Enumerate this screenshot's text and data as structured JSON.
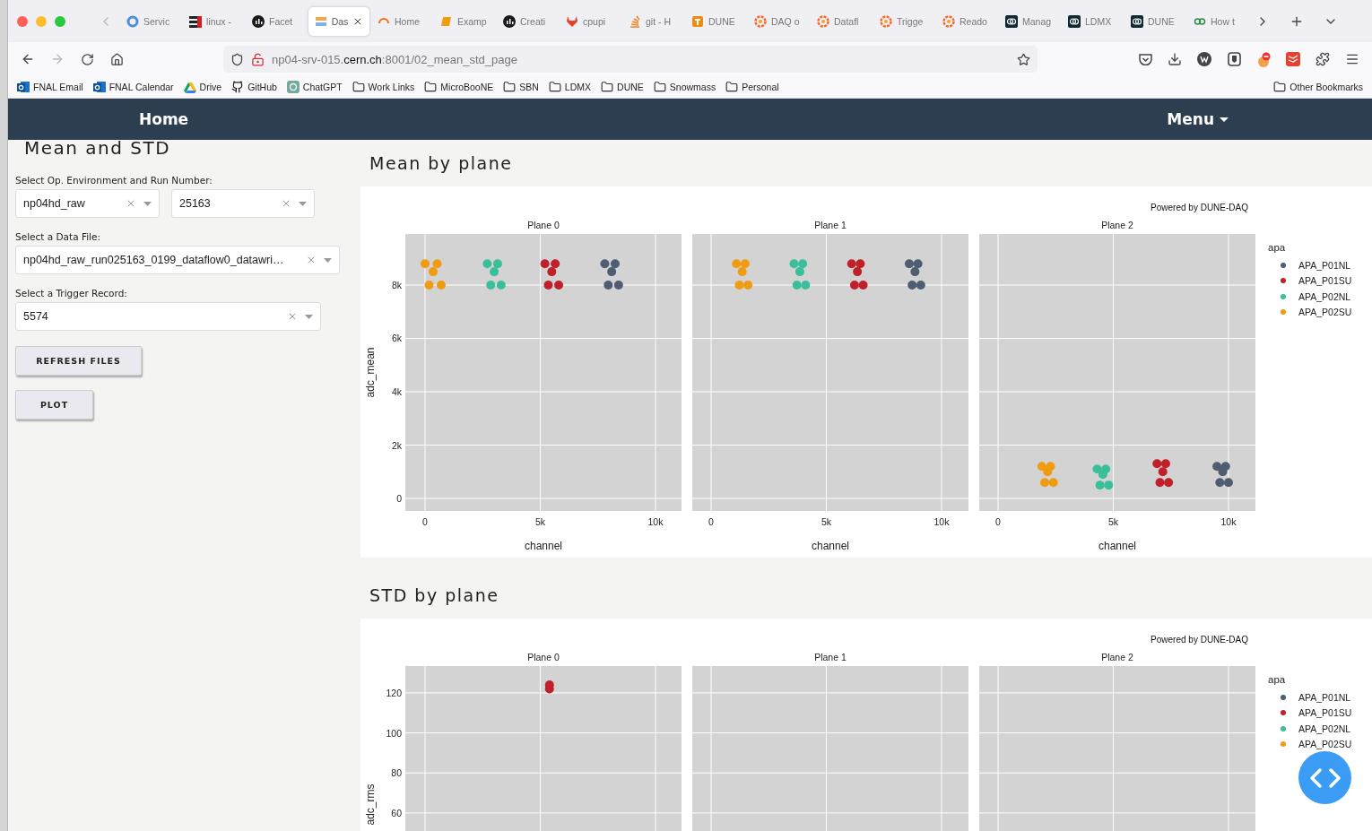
{
  "browser": {
    "tabs": [
      {
        "title": "Servic",
        "kind": "ring",
        "selected": false
      },
      {
        "title": "linux -",
        "kind": "bars",
        "selected": false
      },
      {
        "title": "Facet",
        "kind": "dark",
        "selected": false
      },
      {
        "title": "Das",
        "kind": "dune",
        "selected": true
      },
      {
        "title": "Home",
        "kind": "arc",
        "selected": false
      },
      {
        "title": "Examp",
        "kind": "book",
        "selected": false
      },
      {
        "title": "Creati",
        "kind": "dark",
        "selected": false
      },
      {
        "title": "cpupi",
        "kind": "fox",
        "selected": false
      },
      {
        "title": "git - H",
        "kind": "stack",
        "selected": false
      },
      {
        "title": "DUNE",
        "kind": "tile",
        "selected": false
      },
      {
        "title": "DAQ o",
        "kind": "grafana",
        "selected": false
      },
      {
        "title": "Datafl",
        "kind": "grafana",
        "selected": false
      },
      {
        "title": "Trigge",
        "kind": "grafana",
        "selected": false
      },
      {
        "title": "Reado",
        "kind": "grafana",
        "selected": false
      },
      {
        "title": "Manag",
        "kind": "swirl",
        "selected": false
      },
      {
        "title": "LDMX",
        "kind": "swirl",
        "selected": false
      },
      {
        "title": "DUNE",
        "kind": "swirl",
        "selected": false
      },
      {
        "title": "How t",
        "kind": "gg",
        "selected": false
      }
    ],
    "forward_disabled": true,
    "url": {
      "host": "np04-srv-015.",
      "domain": "cern.ch",
      "path": ":8001/02_mean_std_page"
    },
    "bookmarks": [
      {
        "label": "FNAL Email",
        "kind": "outlook"
      },
      {
        "label": "FNAL Calendar",
        "kind": "outlook"
      },
      {
        "label": "Drive",
        "kind": "drive"
      },
      {
        "label": "GitHub",
        "kind": "github"
      },
      {
        "label": "ChatGPT",
        "kind": "chatgpt"
      },
      {
        "label": "Work Links",
        "kind": "folder"
      },
      {
        "label": "MicroBooNE",
        "kind": "folder"
      },
      {
        "label": "SBN",
        "kind": "folder"
      },
      {
        "label": "LDMX",
        "kind": "folder"
      },
      {
        "label": "DUNE",
        "kind": "folder"
      },
      {
        "label": "Snowmass",
        "kind": "folder"
      },
      {
        "label": "Personal",
        "kind": "folder"
      }
    ],
    "other_bookmarks": "Other Bookmarks"
  },
  "navbar": {
    "home": "Home",
    "menu": "Menu"
  },
  "sidebar": {
    "title": "Mean and STD",
    "env_label": "Select Op. Environment and Run Number:",
    "env_value": "np04hd_raw",
    "run_value": "25163",
    "file_label": "Select a Data File:",
    "file_value": "np04hd_raw_run025163_0199_dataflow0_datawri…",
    "trigger_label": "Select a Trigger Record:",
    "trigger_value": "5574",
    "buttons": [
      "REFRESH FILES",
      "PLOT"
    ]
  },
  "sections": [
    {
      "title": "Mean by plane",
      "powered_by": "Powered by DUNE-DAQ",
      "legend": {
        "title": "apa",
        "items": [
          {
            "label": "APA_P01NL",
            "color": "#4f5d73"
          },
          {
            "label": "APA_P01SU",
            "color": "#c0202a"
          },
          {
            "label": "APA_P02NL",
            "color": "#3bbf9b"
          },
          {
            "label": "APA_P02SU",
            "color": "#f09c12"
          }
        ]
      },
      "facets": [
        {
          "chart_data": {
            "type": "scatter",
            "grid": true,
            "title": "Plane 0",
            "xlabel": "channel",
            "ylabel": "adc_mean",
            "xlim": [
              -856,
              11130
            ],
            "ylim": [
              -470,
              9915
            ],
            "xticks": [
              {
                "value": 0,
                "label": "0"
              },
              {
                "value": 5000,
                "label": "5k"
              },
              {
                "value": 10000,
                "label": "10k"
              }
            ],
            "yticks": [
              {
                "value": 0,
                "label": "0"
              },
              {
                "value": 2000,
                "label": "2k"
              },
              {
                "value": 4000,
                "label": "4k"
              },
              {
                "value": 6000,
                "label": "6k"
              },
              {
                "value": 8000,
                "label": "8k"
              }
            ],
            "series": [
              {
                "color": "#4f5d73",
                "x": [
                  7800,
                  7950,
                  8100,
                  8250,
                  8400
                ],
                "values": [
                  8800,
                  8000,
                  8500,
                  8800,
                  8000
                ]
              },
              {
                "color": "#c0202a",
                "x": [
                  5200,
                  5350,
                  5500,
                  5650,
                  5800
                ],
                "values": [
                  8800,
                  8000,
                  8500,
                  8800,
                  8000
                ]
              },
              {
                "color": "#3bbf9b",
                "x": [
                  2700,
                  2850,
                  3000,
                  3150,
                  3300
                ],
                "values": [
                  8800,
                  8000,
                  8500,
                  8800,
                  8000
                ]
              },
              {
                "color": "#f09c12",
                "x": [
                  0,
                  175,
                  350,
                  525,
                  700
                ],
                "values": [
                  8800,
                  8000,
                  8500,
                  8800,
                  8000
                ]
              }
            ]
          }
        },
        {
          "chart_data": {
            "type": "scatter",
            "grid": true,
            "title": "Plane 1",
            "xlabel": "channel",
            "xlim": [
              -817,
              11170
            ],
            "ylim": [
              -470,
              9915
            ],
            "xticks": [
              {
                "value": 0,
                "label": "0"
              },
              {
                "value": 5000,
                "label": "5k"
              },
              {
                "value": 10000,
                "label": "10k"
              }
            ],
            "series": [
              {
                "color": "#4f5d73",
                "x": [
                  8600,
                  8725,
                  8850,
                  8975,
                  9100
                ],
                "values": [
                  8800,
                  8000,
                  8500,
                  8800,
                  8000
                ]
              },
              {
                "color": "#c0202a",
                "x": [
                  6100,
                  6225,
                  6350,
                  6475,
                  6600
                ],
                "values": [
                  8800,
                  8000,
                  8500,
                  8800,
                  8000
                ]
              },
              {
                "color": "#3bbf9b",
                "x": [
                  3600,
                  3725,
                  3850,
                  3975,
                  4100
                ],
                "values": [
                  8800,
                  8000,
                  8500,
                  8800,
                  8000
                ]
              },
              {
                "color": "#f09c12",
                "x": [
                  1100,
                  1225,
                  1350,
                  1475,
                  1600
                ],
                "values": [
                  8800,
                  8000,
                  8500,
                  8800,
                  8000
                ]
              }
            ]
          }
        },
        {
          "chart_data": {
            "type": "scatter",
            "grid": true,
            "title": "Plane 2",
            "xlabel": "channel",
            "xlim": [
              -817,
              11170
            ],
            "ylim": [
              -470,
              9915
            ],
            "xticks": [
              {
                "value": 0,
                "label": "0"
              },
              {
                "value": 5000,
                "label": "5k"
              },
              {
                "value": 10000,
                "label": "10k"
              }
            ],
            "series": [
              {
                "color": "#4f5d73",
                "x": [
                  9500,
                  9625,
                  9750,
                  9875,
                  10000
                ],
                "values": [
                  1200,
                  600,
                  1000,
                  1200,
                  600
                ]
              },
              {
                "color": "#c0202a",
                "x": [
                  6900,
                  7025,
                  7150,
                  7275,
                  7400
                ],
                "values": [
                  1300,
                  600,
                  1000,
                  1300,
                  600
                ]
              },
              {
                "color": "#3bbf9b",
                "x": [
                  4300,
                  4425,
                  4550,
                  4675,
                  4800
                ],
                "values": [
                  1100,
                  500,
                  900,
                  1100,
                  500
                ]
              },
              {
                "color": "#f09c12",
                "x": [
                  1900,
                  2025,
                  2150,
                  2275,
                  2400
                ],
                "values": [
                  1200,
                  600,
                  1000,
                  1200,
                  600
                ]
              }
            ]
          }
        }
      ]
    },
    {
      "title": "STD by plane",
      "powered_by": "Powered by DUNE-DAQ",
      "legend": {
        "title": "apa",
        "items": [
          {
            "label": "APA_P01NL",
            "color": "#4f5d73"
          },
          {
            "label": "APA_P01SU",
            "color": "#c0202a"
          },
          {
            "label": "APA_P02NL",
            "color": "#3bbf9b"
          },
          {
            "label": "APA_P02SU",
            "color": "#f09c12"
          }
        ]
      },
      "facets": [
        {
          "chart_data": {
            "type": "scatter",
            "grid": true,
            "title": "Plane 0",
            "ylabel": "adc_rms",
            "xlim": [
              -856,
              11130
            ],
            "ylim": [
              -5,
              133.4
            ],
            "yticks": [
              {
                "value": 60,
                "label": "60"
              },
              {
                "value": 80,
                "label": "80"
              },
              {
                "value": 100,
                "label": "100"
              },
              {
                "value": 120,
                "label": "120"
              }
            ],
            "series": [
              {
                "color": "#c0202a",
                "x": [
                  5400,
                  5400
                ],
                "values": [
                  122,
                  124
                ]
              }
            ]
          }
        },
        {
          "chart_data": {
            "type": "scatter",
            "grid": true,
            "title": "Plane 1",
            "xlim": [
              -817,
              11170
            ],
            "ylim": [
              -5,
              133.4
            ]
          }
        },
        {
          "chart_data": {
            "type": "scatter",
            "grid": true,
            "title": "Plane 2",
            "xlim": [
              -817,
              11170
            ],
            "ylim": [
              -5,
              133.4
            ]
          }
        }
      ]
    }
  ]
}
